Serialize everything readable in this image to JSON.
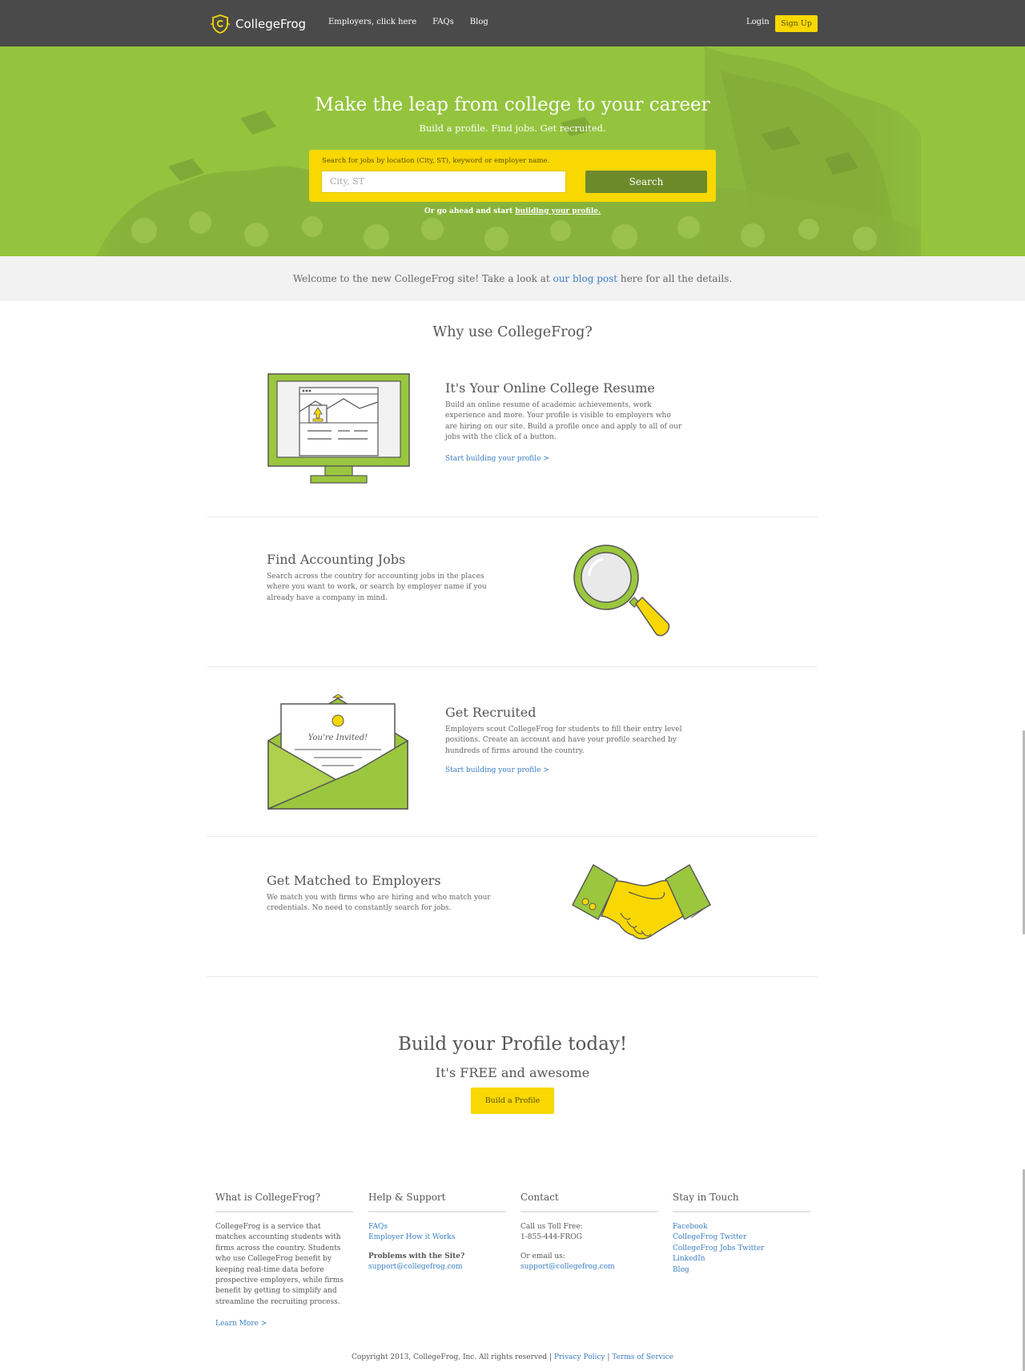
{
  "header": {
    "logo_text": "CollegeFrog",
    "nav": [
      "Employers, click here",
      "FAQs",
      "Blog"
    ],
    "login": "Login",
    "signup": "Sign Up"
  },
  "hero": {
    "title": "Make the leap from college to your career",
    "subtitle": "Build a profile. Find jobs. Get recruited.",
    "search_label": "Search for jobs by location (City, ST), keyword or employer name.",
    "search_placeholder": "City, ST",
    "search_button": "Search",
    "alt_prefix": "Or go ahead and start ",
    "alt_link": "building your profile."
  },
  "notice": {
    "prefix": "Welcome to the new CollegeFrog site! Take a look at ",
    "link": "our blog post",
    "suffix": " here for all the details."
  },
  "why_title": "Why use CollegeFrog?",
  "features": [
    {
      "title": "It's Your Online College Resume",
      "lines": [
        "Build an online resume of academic achievements, work",
        "experience and more. Your profile is visible to employers who",
        "are hiring on our site. Build a profile once and apply to all of our",
        "jobs with the click of a button."
      ],
      "link": "Start building your profile >",
      "icon": "monitor-resume-icon"
    },
    {
      "title": "Find Accounting Jobs",
      "lines": [
        "Search across the country for accounting jobs in the places",
        "where you want to work, or search by employer name if you",
        "already have a company in mind."
      ],
      "link": "",
      "icon": "magnifier-icon"
    },
    {
      "title": "Get Recruited",
      "lines": [
        "Employers scout CollegeFrog for students to fill their entry level",
        "positions. Create an account and have your profile searched by",
        "hundreds of firms around the country."
      ],
      "link": "Start building your profile >",
      "icon": "invitation-envelope-icon",
      "envelope_text": "You're Invited!"
    },
    {
      "title": "Get Matched to Employers",
      "lines": [
        "We match you with firms who are hiring and who match your",
        "credentials. No need to constantly search for jobs."
      ],
      "link": "",
      "icon": "handshake-icon"
    }
  ],
  "cta": {
    "title": "Build your Profile today!",
    "subtitle": "It's FREE and awesome",
    "button": "Build a Profile"
  },
  "footer": {
    "what": {
      "heading": "What is CollegeFrog?",
      "lines": [
        "CollegeFrog is a service that",
        "matches accounting students with",
        "firms across the country. Students",
        "who use CollegeFrog benefit by",
        "keeping real-time data before",
        "prospective employers, while firms",
        "benefit by getting to simplify and",
        "streamline the recruiting process."
      ],
      "link": "Learn More >"
    },
    "help": {
      "heading": "Help & Support",
      "links": [
        "FAQs",
        "Employer How it Works"
      ],
      "problems": "Problems with the Site?",
      "email": "support@collegefrog.com"
    },
    "contact": {
      "heading": "Contact",
      "call": "Call us Toll Free:",
      "phone": "1-855-444-FROG",
      "email_label": "Or email us:",
      "email": "support@collegefrog.com"
    },
    "social": {
      "heading": "Stay in Touch",
      "links": [
        "Facebook",
        "CollegeFrog Twitter",
        "CollegeFrog Jobs Twitter",
        "LinkedIn",
        "Blog"
      ]
    },
    "copyright": "Copyright 2013, CollegeFrog, Inc. All rights reserved | ",
    "privacy": "Privacy Policy",
    "sep": " | ",
    "terms": "Terms of Service"
  },
  "colors": {
    "header_bg": "#4a4a4a",
    "hero_green": "#94c43e",
    "accent_yellow": "#f8d800",
    "search_button": "#6d8a2b",
    "link_blue": "#3b7fc4"
  }
}
